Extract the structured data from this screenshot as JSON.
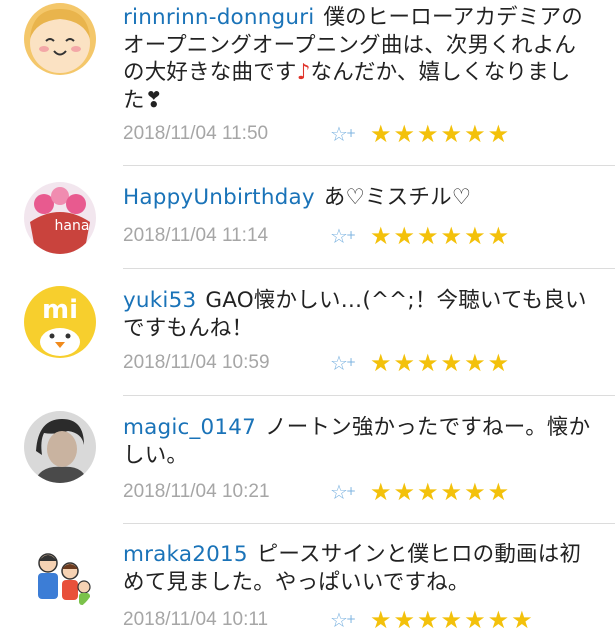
{
  "comments": [
    {
      "username": "rinnrinn-donnguri",
      "text": "僕のヒーローアカデミアのオープニングオープニング曲は、次男くれよんの大好きな曲です",
      "note": "♪",
      "text2": "なんだか、嬉しくなりました❣",
      "timestamp": "2018/11/04 11:50",
      "stars_text": "★★★★★★",
      "stars": 6
    },
    {
      "username": "HappyUnbirthday",
      "text": "あ♡ミスチル♡",
      "avatar_text": "hana",
      "timestamp": "2018/11/04 11:14",
      "stars_text": "★★★★★★",
      "stars": 6
    },
    {
      "username": "yuki53",
      "text": "GAO懐かしい…(^^;！今聴いても良いですもんね！",
      "avatar_text": "mi",
      "timestamp": "2018/11/04 10:59",
      "stars_text": "★★★★★★",
      "stars": 6
    },
    {
      "username": "magic_0147",
      "text": "ノートン強かったですねー。懐かしい。",
      "timestamp": "2018/11/04 10:21",
      "stars_text": "★★★★★★",
      "stars": 6
    },
    {
      "username": "mraka2015",
      "text": "ピースサインと僕ヒロの動画は初めて見ました。やっぱいいですね。",
      "timestamp": "2018/11/04 10:11",
      "stars_text": "★★★★★★★",
      "stars": 7
    }
  ],
  "icons": {
    "favorite_add": "star-plus-icon",
    "rating": "star-icon"
  },
  "colors": {
    "username": "#1a73b8",
    "timestamp": "#a6a6a6",
    "star": "#f3c10b",
    "favorite_icon": "#7cb3e0",
    "note": "#e0332a",
    "divider": "#dcdcdc"
  }
}
